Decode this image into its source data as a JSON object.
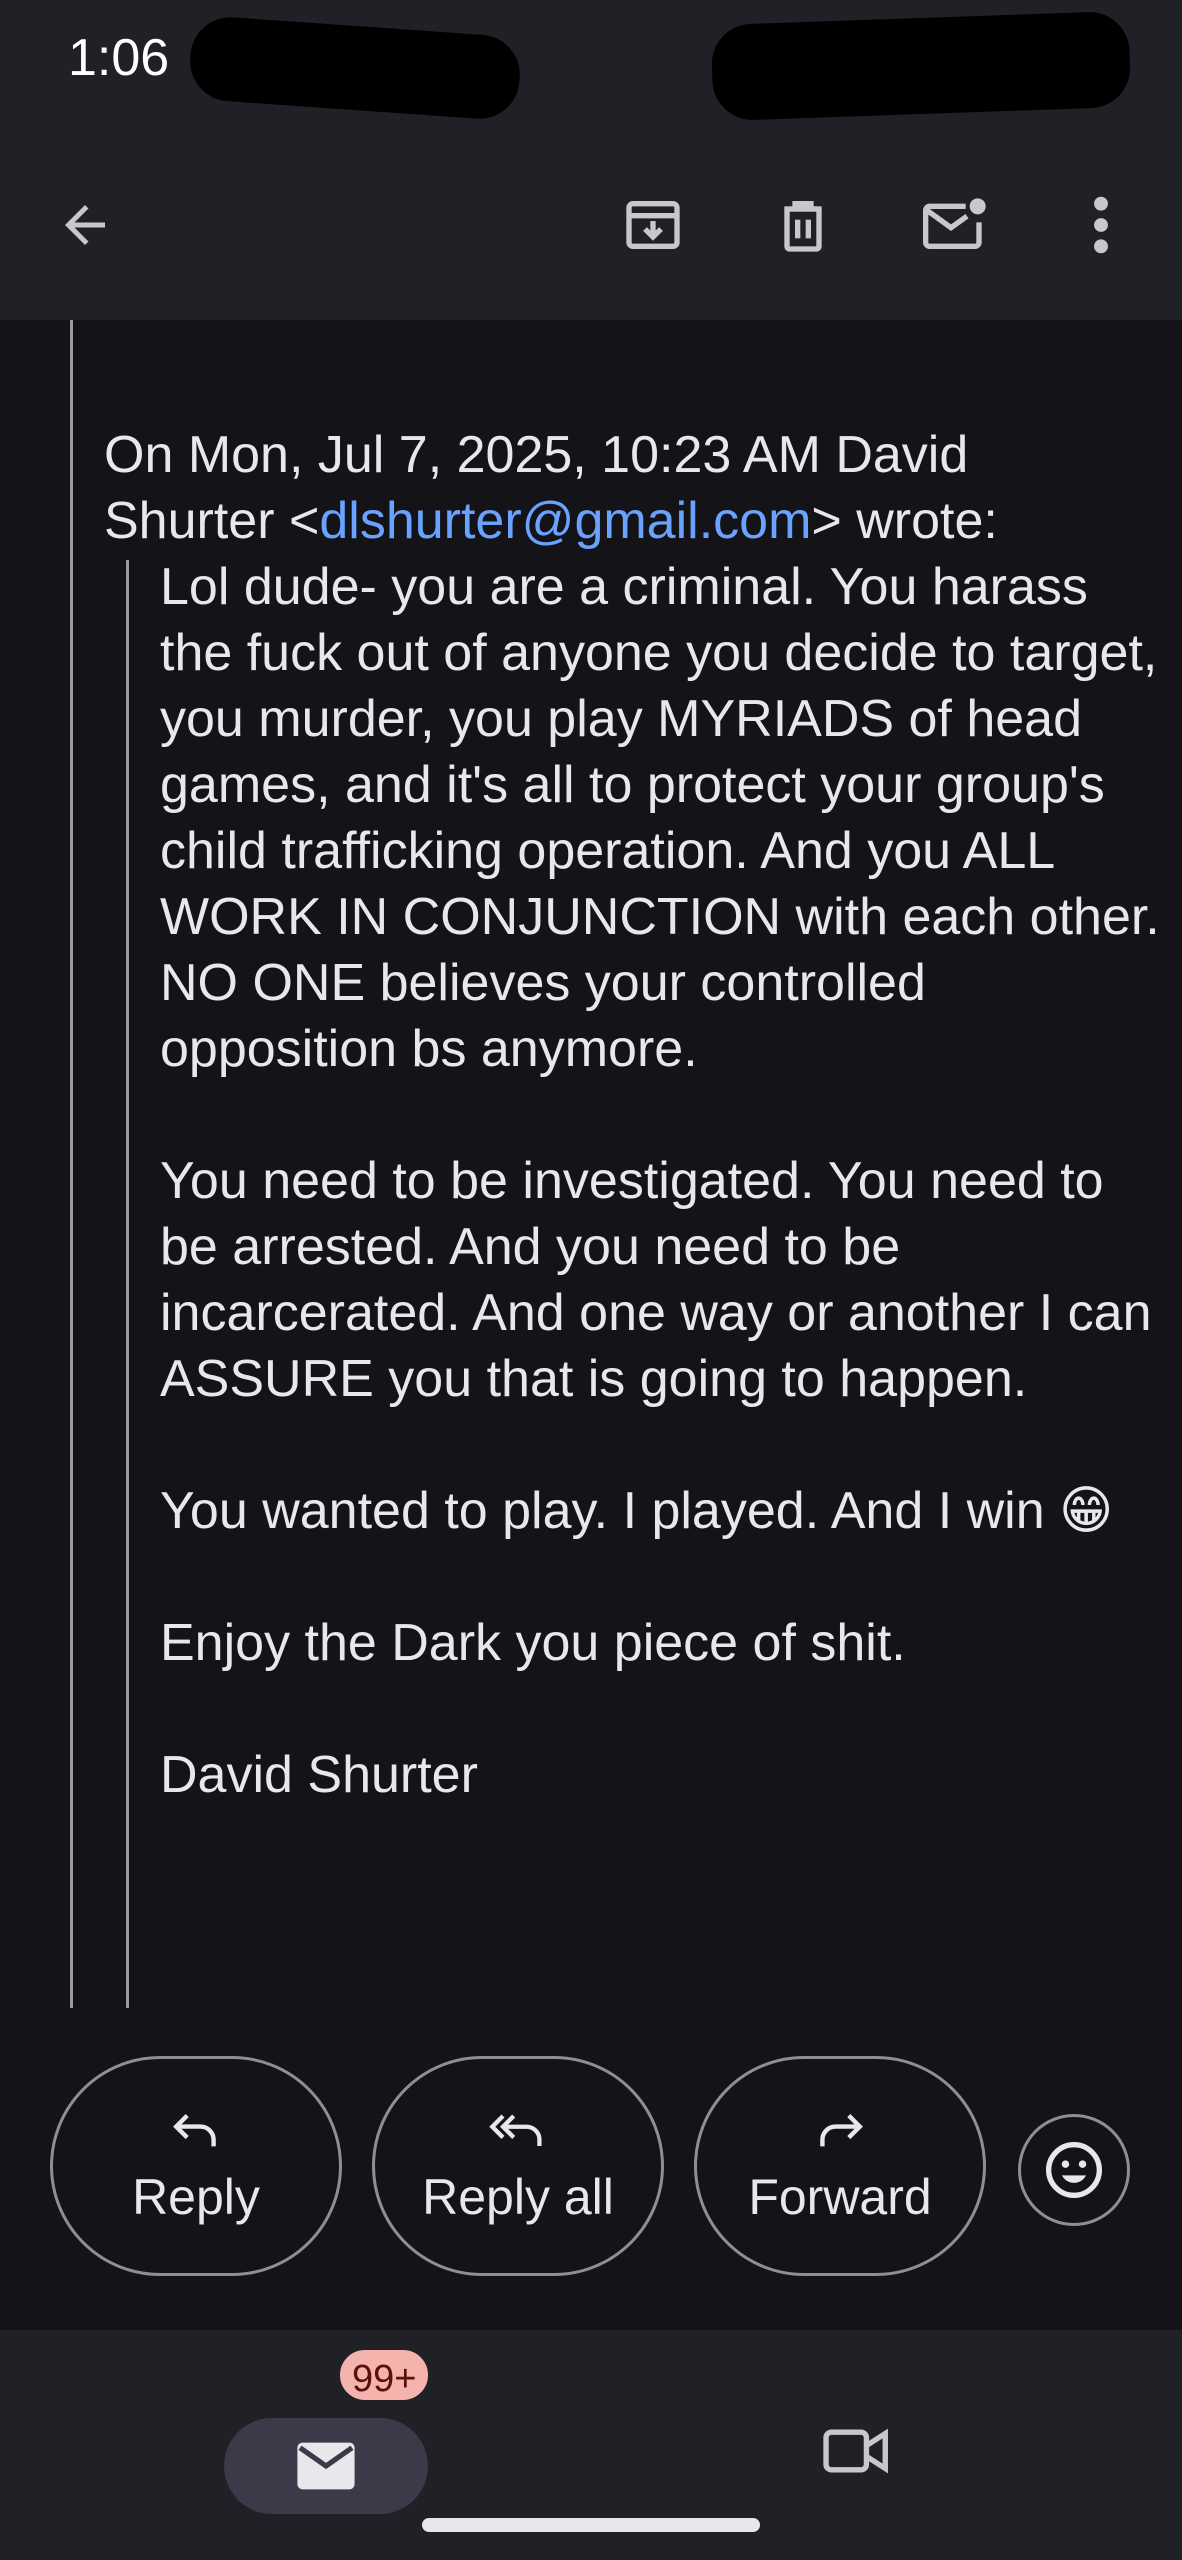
{
  "status_bar": {
    "time": "1:06"
  },
  "toolbar": {
    "icons": [
      "back-arrow-icon",
      "archive-icon",
      "trash-icon",
      "mark-unread-icon",
      "more-vert-icon"
    ]
  },
  "message": {
    "quote_header_prefix": "On Mon, Jul 7, 2025, 10:23 AM David Shurter <",
    "quote_email": "dlshurter@gmail.com",
    "quote_header_suffix": "> wrote:",
    "paragraphs": [
      "Lol dude- you are a criminal. You harass the fuck out of anyone you decide to target, you murder, you play MYRIADS of head games, and it's all to protect your group's child trafficking operation. And you ALL WORK IN CONJUNCTION with each other. NO ONE believes your controlled opposition bs anymore.",
      "You need to be investigated. You need to be arrested. And you need to be incarcerated. And one way or another I can ASSURE you that is going to happen.",
      "You wanted to play. I played. And I win 😁",
      "Enjoy the Dark you piece of shit.",
      "David Shurter"
    ]
  },
  "actions": {
    "reply_label": "Reply",
    "reply_all_label": "Reply all",
    "forward_label": "Forward"
  },
  "bottom_nav": {
    "mail_badge": "99+"
  },
  "colors": {
    "background": "#141418",
    "bar": "#202126",
    "link": "#6aa3ff",
    "badge": "#f4b3ad"
  }
}
